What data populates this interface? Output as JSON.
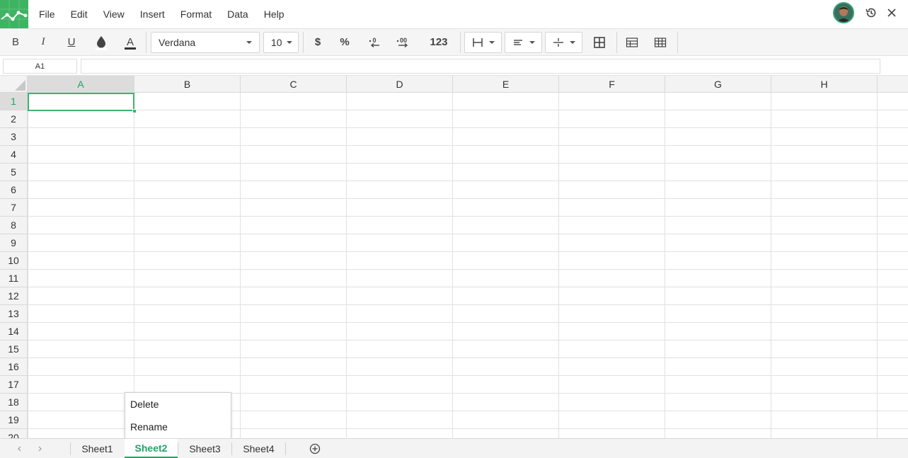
{
  "menu": [
    "File",
    "Edit",
    "View",
    "Insert",
    "Format",
    "Data",
    "Help"
  ],
  "toolbar": {
    "bold": "B",
    "italic": "I",
    "underline": "U",
    "font_family": "Verdana",
    "font_size": "10",
    "currency": "$",
    "percent": "%",
    "number_format": "123"
  },
  "formula_bar": {
    "cell_ref": "A1",
    "formula": ""
  },
  "columns": [
    "A",
    "B",
    "C",
    "D",
    "E",
    "F",
    "G",
    "H"
  ],
  "rows": [
    "1",
    "2",
    "3",
    "4",
    "5",
    "6",
    "7",
    "8",
    "9",
    "10",
    "11",
    "12",
    "13",
    "14",
    "15",
    "16",
    "17",
    "18",
    "19",
    "20"
  ],
  "selected_cell": "A1",
  "context_menu": {
    "delete": "Delete",
    "rename": "Rename"
  },
  "sheets": [
    "Sheet1",
    "Sheet2",
    "Sheet3",
    "Sheet4"
  ],
  "active_sheet": "Sheet2",
  "colors": {
    "brand": "#3eb362",
    "accent": "#21a366"
  }
}
